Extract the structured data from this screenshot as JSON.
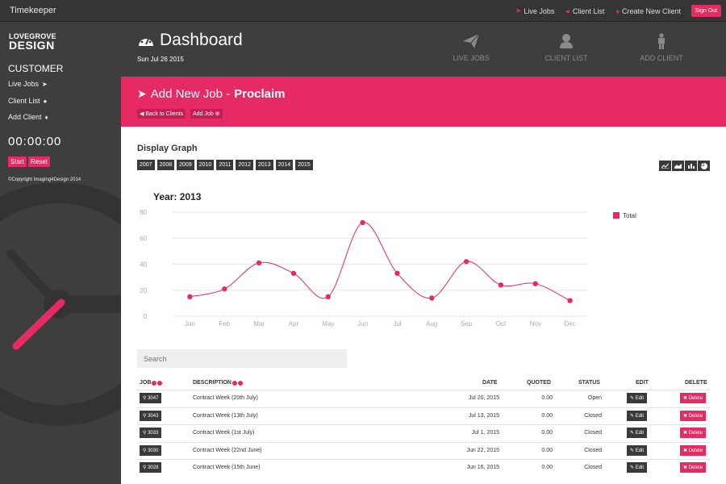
{
  "topbar": {
    "brand": "Timekeeper",
    "nav": [
      {
        "label": "Live Jobs",
        "icon": "paper-plane-icon"
      },
      {
        "label": "Client List",
        "icon": "user-icon"
      },
      {
        "label": "Create New Client",
        "icon": "person-icon"
      }
    ],
    "signout": "Sign Out"
  },
  "sidebar": {
    "logo_line1": "LOVEGROVE",
    "logo_line2": "DESIGN",
    "heading": "CUSTOMER",
    "links": [
      "Live Jobs",
      "Client List",
      "Add Client"
    ],
    "timer": "00:00:00",
    "start": "Start",
    "reset": "Reset",
    "copyright": "©Copyright Imaging4Design 2014"
  },
  "header": {
    "title": "Dashboard",
    "date": "Sun Jul 26 2015",
    "quick": [
      "LIVE JOBS",
      "CLIENT LIST",
      "ADD CLIENT"
    ]
  },
  "banner": {
    "title_prefix": "Add New Job - ",
    "title_client": "Proclaim",
    "back": "Back to Clients",
    "add_job": "Add Job"
  },
  "graph": {
    "heading": "Display Graph",
    "years": [
      "2007",
      "2008",
      "2009",
      "2010",
      "2011",
      "2012",
      "2013",
      "2014",
      "2015"
    ]
  },
  "chart_data": {
    "type": "line",
    "title": "Year: 2013",
    "categories": [
      "Jan",
      "Feb",
      "Mar",
      "Apr",
      "May",
      "Jun",
      "Jul",
      "Aug",
      "Sep",
      "Oct",
      "Nov",
      "Dec"
    ],
    "series": [
      {
        "name": "Total",
        "values": [
          15,
          21,
          41,
          33,
          15,
          72,
          33,
          14,
          42,
          24,
          25,
          12
        ]
      }
    ],
    "yticks": [
      0,
      20,
      40,
      60,
      80
    ],
    "ylim": [
      0,
      80
    ],
    "grid": true,
    "legend": "right",
    "color": "#e62a64"
  },
  "search": {
    "placeholder": "Search"
  },
  "table": {
    "columns": [
      "JOB",
      "DESCRIPTION",
      "DATE",
      "QUOTED",
      "STATUS",
      "EDIT",
      "DELETE"
    ],
    "edit_label": "Edit",
    "delete_label": "Delete",
    "rows": [
      {
        "job": "3047",
        "description": "Contract Week (20th July)",
        "date": "Jul 20, 2015",
        "quoted": "0.00",
        "status": "Open"
      },
      {
        "job": "3043",
        "description": "Contract Week (13th July)",
        "date": "Jul 13, 2015",
        "quoted": "0.00",
        "status": "Closed"
      },
      {
        "job": "3033",
        "description": "Contract Week (1st July)",
        "date": "Jul 1, 2015",
        "quoted": "0.00",
        "status": "Closed"
      },
      {
        "job": "3030",
        "description": "Contract Week (22nd June)",
        "date": "Jun 22, 2015",
        "quoted": "0.00",
        "status": "Closed"
      },
      {
        "job": "3028",
        "description": "Contract Week (15th June)",
        "date": "Jun 16, 2015",
        "quoted": "0.00",
        "status": "Closed"
      }
    ]
  }
}
